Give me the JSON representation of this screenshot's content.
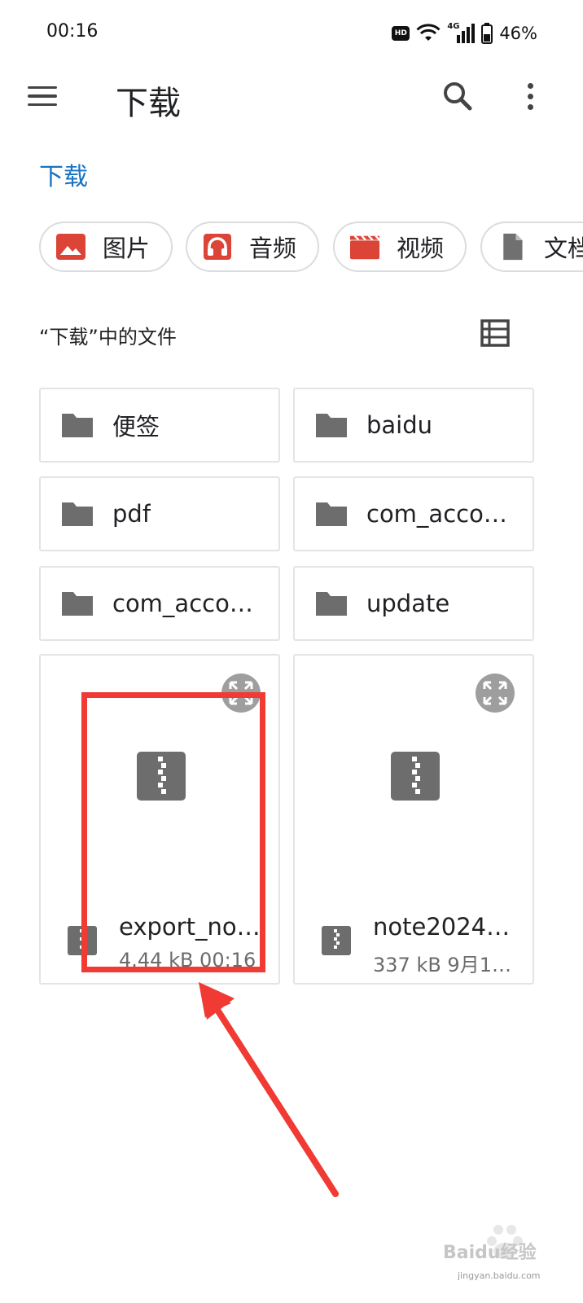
{
  "status_bar": {
    "time": "00:16",
    "battery": "46%",
    "hd_label": "HD",
    "network_label": "4G"
  },
  "app_bar": {
    "title": "下载",
    "icons": [
      "menu-icon",
      "search-icon",
      "more-vert-icon"
    ]
  },
  "breadcrumb": "下载",
  "chips": [
    {
      "label": "图片",
      "icon": "image-icon",
      "color": "#db4437"
    },
    {
      "label": "音频",
      "icon": "headphones-icon",
      "color": "#db4437"
    },
    {
      "label": "视频",
      "icon": "video-icon",
      "color": "#db4437"
    },
    {
      "label": "文档",
      "icon": "document-icon",
      "color": "#707070"
    }
  ],
  "section": {
    "title": "“下载”中的文件",
    "view_icon": "list-view-icon"
  },
  "folders": [
    {
      "name": "便签"
    },
    {
      "name": "baidu"
    },
    {
      "name": "pdf"
    },
    {
      "name": "com_acco…"
    },
    {
      "name": "com_acco…"
    },
    {
      "name": "update"
    }
  ],
  "files": [
    {
      "name": "export_not…",
      "meta": "4.44 kB 00:16",
      "icon": "zip-icon"
    },
    {
      "name": "note2024-…",
      "meta": "337 kB 9月1…",
      "icon": "zip-icon"
    }
  ],
  "annotation": {
    "color": "#f03a33"
  },
  "watermark": {
    "brand": "Baidu经验",
    "url": "jingyan.baidu.com"
  }
}
